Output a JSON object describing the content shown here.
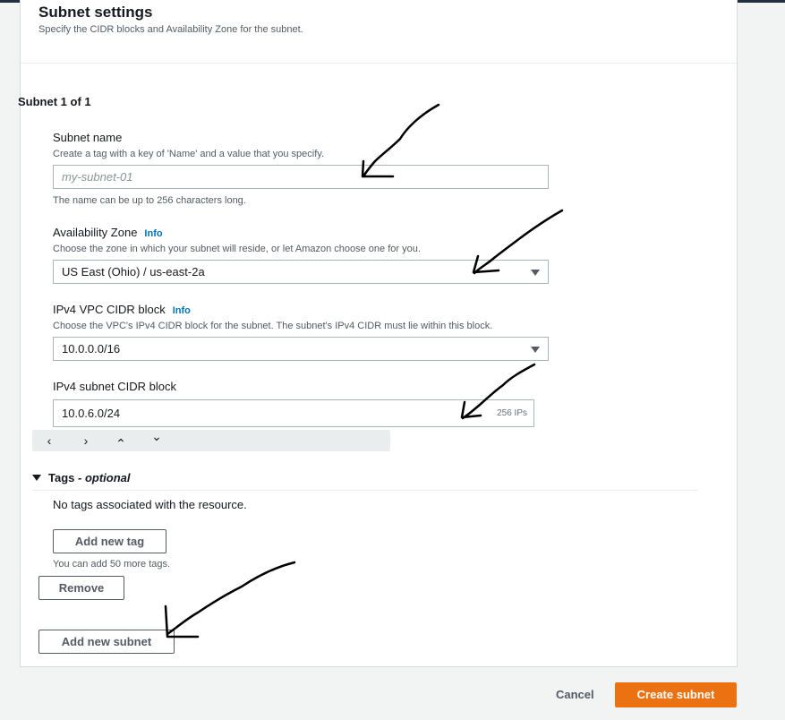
{
  "section": {
    "title": "Subnet settings",
    "description": "Specify the CIDR blocks and Availability Zone for the subnet."
  },
  "subnet": {
    "count_label": "Subnet 1 of 1",
    "name": {
      "label": "Subnet name",
      "description": "Create a tag with a key of 'Name' and a value that you specify.",
      "placeholder": "my-subnet-01",
      "constraint": "The name can be up to 256 characters long."
    },
    "az": {
      "label": "Availability Zone",
      "info": "Info",
      "description": "Choose the zone in which your subnet will reside, or let Amazon choose one for you.",
      "value": "US East (Ohio) / us-east-2a"
    },
    "vpc_cidr": {
      "label": "IPv4 VPC CIDR block",
      "info": "Info",
      "description": "Choose the VPC's IPv4 CIDR block for the subnet. The subnet's IPv4 CIDR must lie within this block.",
      "value": "10.0.0.0/16"
    },
    "subnet_cidr": {
      "label": "IPv4 subnet CIDR block",
      "value": "10.0.6.0/24",
      "ips": "256 IPs"
    },
    "stepper": {
      "prev": "‹",
      "next": "›",
      "up": "⌃",
      "down": "⌄"
    },
    "tags": {
      "title": "Tags",
      "optional": "- optional",
      "empty_text": "No tags associated with the resource.",
      "add_button": "Add new tag",
      "limit_text": "You can add 50 more tags."
    },
    "remove_button": "Remove"
  },
  "add_subnet_button": "Add new subnet",
  "footer": {
    "cancel": "Cancel",
    "create": "Create subnet"
  },
  "colors": {
    "accent": "#ec7211",
    "link": "#0073bb",
    "annotation": "#000000"
  }
}
